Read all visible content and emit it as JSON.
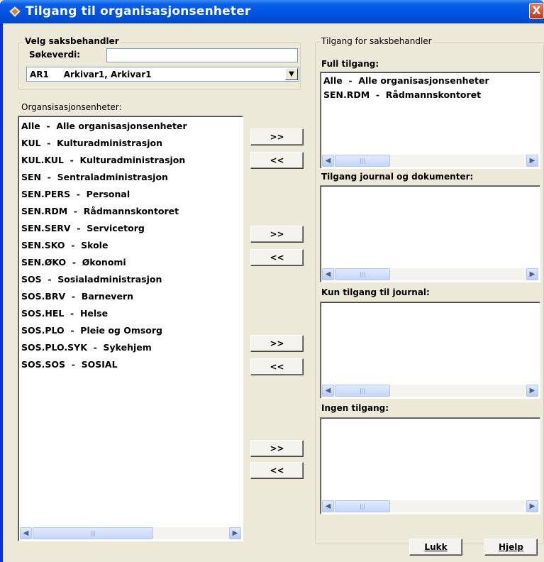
{
  "window": {
    "title": "Tilgang til organisasjonsenheter",
    "close_label": "X"
  },
  "left_group": {
    "legend": "Velg saksbehandler",
    "search_label": "Søkeverdi:",
    "search_value": "",
    "combo_value": "AR1     Arkivar1, Arkivar1",
    "combo_arrow": "▼"
  },
  "org_list": {
    "label": "Organsisasjonsenheter:",
    "items": [
      "Alle  -  Alle organisasjonsenheter",
      "KUL  -  Kulturadministrasjon",
      "KUL.KUL  -  Kulturadministrasjon",
      "SEN  -  Sentraladministrasjon",
      "SEN.PERS  -  Personal",
      "SEN.RDM  -  Rådmannskontoret",
      "SEN.SERV  -  Servicetorg",
      "SEN.SKO  -  Skole",
      "SEN.ØKO  -  Økonomi",
      "SOS  -  Sosialadministrasjon",
      "SOS.BRV  -  Barnevern",
      "SOS.HEL  -  Helse",
      "SOS.PLO  -  Pleie og Omsorg",
      "SOS.PLO.SYK  -  Sykehjem",
      "SOS.SOS  -  SOSIAL"
    ]
  },
  "transfer": {
    "add_label": ">>",
    "remove_label": "<<"
  },
  "right_group": {
    "legend": "Tilgang for saksbehandler",
    "full_label": "Full tilgang:",
    "full_items": [
      "Alle  -  Alle organisasjonsenheter",
      "SEN.RDM  -  Rådmannskontoret"
    ],
    "journal_doc_label": "Tilgang journal og dokumenter:",
    "journal_only_label": "Kun tilgang til journal:",
    "none_label": "Ingen tilgang:"
  },
  "scrollbar": {
    "left_arrow": "◀",
    "right_arrow": "▶",
    "thumb_grip": "|||"
  },
  "footer": {
    "close_label": "Lukk",
    "help_label": "Hjelp"
  }
}
